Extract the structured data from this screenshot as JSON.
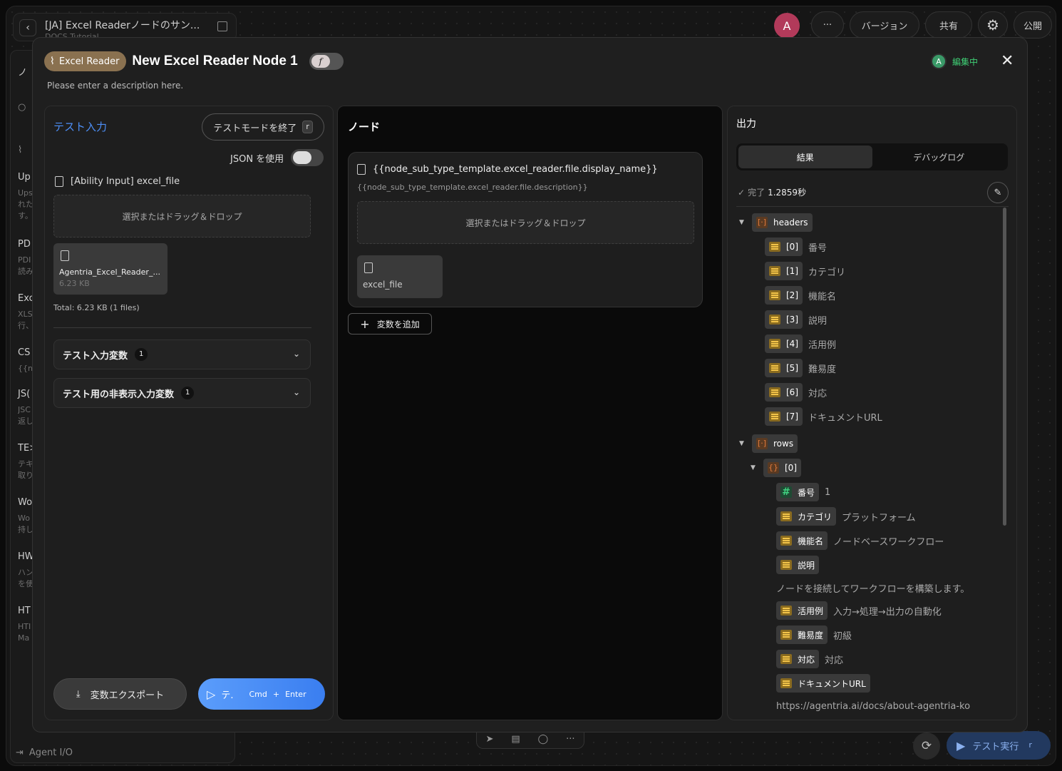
{
  "workflow": {
    "title": "[JA] Excel Readerノードのサン...",
    "subtitle": "DOCS Tutorial",
    "back_label": "‹"
  },
  "topbar": {
    "avatar_letter": "A",
    "more_label": "···",
    "version_label": "バージョン",
    "share_label": "共有",
    "publish_label": "公開"
  },
  "sidebar": {
    "items": [
      {
        "title": "Up",
        "desc": "Ups れた す。"
      },
      {
        "title": "PD",
        "desc": "PDI 読み"
      },
      {
        "title": "Exc",
        "desc": "XLS 行、"
      },
      {
        "title": "CS",
        "desc": "{{nc"
      },
      {
        "title": "JS(",
        "desc": "JSC 返し"
      },
      {
        "title": "TE>",
        "desc": "テキ 取り"
      },
      {
        "title": "Wo",
        "desc": "Wo 持し"
      },
      {
        "title": "HW",
        "desc": "ハン を使"
      },
      {
        "title": "HT",
        "desc": "HTI Ma"
      }
    ],
    "search_label": "ノ",
    "agent_io_label": "Agent I/O",
    "agent_io_shortcut": "?  >"
  },
  "modal": {
    "badge_label": "Excel Reader",
    "node_title": "New Excel Reader Node 1",
    "fx_label": "f",
    "description": "Please enter a description here.",
    "editing_avatar": "A",
    "editing_label": "編集中",
    "close_label": "✕"
  },
  "left_panel": {
    "title": "テスト入力",
    "exit_button": "テストモードを終了",
    "exit_shortcut": "r",
    "json_label": "JSON を使用",
    "file_field_label": "[Ability Input] excel_file",
    "dropzone_label": "選択またはドラッグ＆ドロップ",
    "file_name": "Agentria_Excel_Reader_...",
    "file_size": "6.23 KB",
    "total_label": "Total: 6.23 KB (1 files)",
    "accordions": [
      {
        "label": "テスト入力変数",
        "count": "1"
      },
      {
        "label": "テスト用の非表示入力変数",
        "count": "1"
      }
    ],
    "export_button": "変数エクスポート",
    "run_button_text": "テ.",
    "run_shortcut_cmd": "Cmd",
    "run_shortcut_plus": "+",
    "run_shortcut_enter": "Enter"
  },
  "mid_panel": {
    "title": "ノード",
    "field_name": "{{node_sub_type_template.excel_reader.file.display_name}}",
    "field_desc": "{{node_sub_type_template.excel_reader.file.description}}",
    "dropzone_label": "選択またはドラッグ＆ドロップ",
    "variable_name": "excel_file",
    "add_variable_button": "変数を追加"
  },
  "right_panel": {
    "title": "出力",
    "tabs": [
      "結果",
      "デバッグログ"
    ],
    "status_label": "完了",
    "status_time": "1.2859秒",
    "tree": {
      "headers_key": "headers",
      "headers": [
        {
          "index": "[0]",
          "value": "番号"
        },
        {
          "index": "[1]",
          "value": "カテゴリ"
        },
        {
          "index": "[2]",
          "value": "機能名"
        },
        {
          "index": "[3]",
          "value": "説明"
        },
        {
          "index": "[4]",
          "value": "活用例"
        },
        {
          "index": "[5]",
          "value": "難易度"
        },
        {
          "index": "[6]",
          "value": "対応"
        },
        {
          "index": "[7]",
          "value": "ドキュメントURL"
        }
      ],
      "rows_key": "rows",
      "row0_key": "[0]",
      "row0": {
        "num_key": "番号",
        "num_val": "1",
        "cat_key": "カテゴリ",
        "cat_val": "プラットフォーム",
        "func_key": "機能名",
        "func_val": "ノードベースワークフロー",
        "desc_key": "説明",
        "desc_val": "ノードを接続してワークフローを構築します。",
        "use_key": "活用例",
        "use_val": "入力→処理→出力の自動化",
        "diff_key": "難易度",
        "diff_val": "初級",
        "sup_key": "対応",
        "sup_val": "対応",
        "url_key": "ドキュメントURL",
        "url_val": "https://agentria.ai/docs/about-agentria-ko"
      }
    }
  },
  "bottom": {
    "test_run_label": "テスト実行",
    "test_run_shortcut": "r"
  }
}
